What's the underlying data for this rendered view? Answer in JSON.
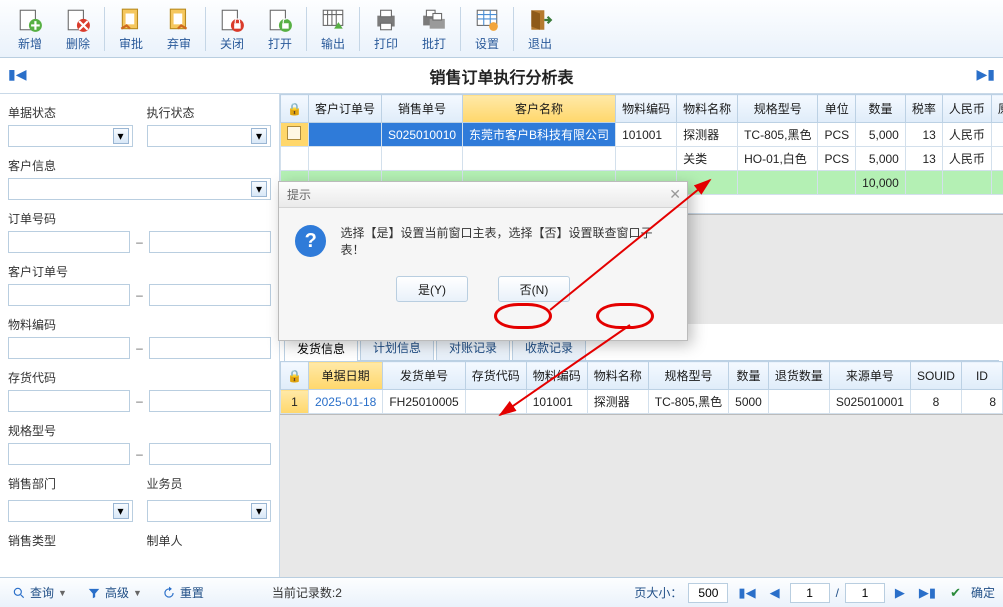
{
  "toolbar": {
    "new": "新增",
    "delete": "删除",
    "approve": "审批",
    "abandon": "弃审",
    "close": "关闭",
    "open": "打开",
    "export": "输出",
    "print": "打印",
    "batchprint": "批打",
    "settings": "设置",
    "exit": "退出"
  },
  "title": "销售订单执行分析表",
  "filters": {
    "doc_status": "单据状态",
    "exec_status": "执行状态",
    "customer": "客户信息",
    "order_no": "订单号码",
    "cust_order_no": "客户订单号",
    "material_code": "物料编码",
    "stock_code": "存货代码",
    "spec": "规格型号",
    "dept": "销售部门",
    "salesman": "业务员",
    "sale_type": "销售类型",
    "creator": "制单人"
  },
  "grid1": {
    "headers": {
      "custorder": "客户订单号",
      "saleno": "销售单号",
      "custname": "客户名称",
      "matcode": "物料编码",
      "matname": "物料名称",
      "spec": "规格型号",
      "unit": "单位",
      "qty": "数量",
      "taxrate": "税率",
      "currency": "人民币",
      "orig": "原"
    },
    "rows": [
      {
        "custorder": "",
        "saleno": "S025010010",
        "custname": "东莞市客户B科技有限公司",
        "matcode": "101001",
        "matname": "探测器",
        "spec": "TC-805,黑色",
        "unit": "PCS",
        "qty": "5,000",
        "taxrate": "13",
        "currency": "人民币"
      },
      {
        "custorder": "",
        "saleno": "",
        "custname": "",
        "matcode": "",
        "matname": "关类",
        "spec": "HO-01,白色",
        "unit": "PCS",
        "qty": "5,000",
        "taxrate": "13",
        "currency": "人民币"
      }
    ],
    "sum_qty": "10,000"
  },
  "tabs": {
    "t1": "发货信息",
    "t2": "计划信息",
    "t3": "对账记录",
    "t4": "收款记录"
  },
  "grid2": {
    "headers": {
      "docdate": "单据日期",
      "shipno": "发货单号",
      "stockcode": "存货代码",
      "matcode": "物料编码",
      "matname": "物料名称",
      "spec": "规格型号",
      "qty": "数量",
      "retqty": "退货数量",
      "srcno": "来源单号",
      "souid": "SOUID",
      "id": "ID"
    },
    "row": {
      "idx": "1",
      "docdate": "2025-01-18",
      "shipno": "FH25010005",
      "stockcode": "",
      "matcode": "101001",
      "matname": "探测器",
      "spec": "TC-805,黑色",
      "qty": "5000",
      "retqty": "",
      "srcno": "S025010001",
      "souid": "8",
      "id": "8"
    }
  },
  "dialog": {
    "title": "提示",
    "msg": "选择【是】设置当前窗口主表，选择【否】设置联查窗口子表！",
    "yes": "是(Y)",
    "no": "否(N)"
  },
  "bottom": {
    "query": "查询",
    "advanced": "高级",
    "reset": "重置",
    "status": "当前记录数:2",
    "pagesize_lbl": "页大小：",
    "pagesize": "500",
    "page": "1",
    "pages": "1",
    "confirm": "确定"
  }
}
